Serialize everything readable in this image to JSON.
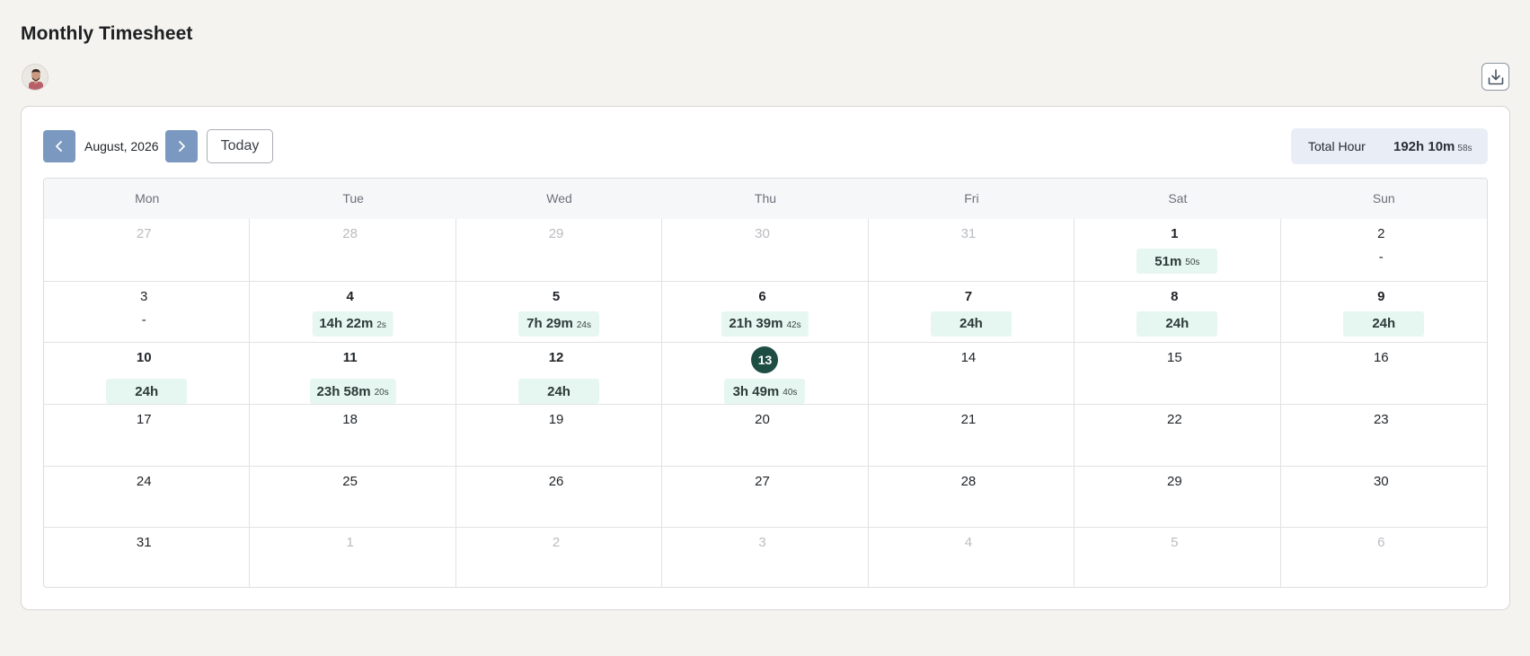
{
  "page": {
    "title": "Monthly Timesheet"
  },
  "toolbar": {
    "month_label": "August, 2026",
    "today_label": "Today",
    "prev_icon": "chevron-left-icon",
    "next_icon": "chevron-right-icon",
    "download_icon": "download-icon"
  },
  "total": {
    "label": "Total Hour",
    "value": "192h 10m",
    "seconds": "58s"
  },
  "calendar": {
    "weekdays": [
      "Mon",
      "Tue",
      "Wed",
      "Thu",
      "Fri",
      "Sat",
      "Sun"
    ],
    "cells": [
      {
        "day": "27",
        "muted": true
      },
      {
        "day": "28",
        "muted": true
      },
      {
        "day": "29",
        "muted": true
      },
      {
        "day": "30",
        "muted": true
      },
      {
        "day": "31",
        "muted": true
      },
      {
        "day": "1",
        "bold": true,
        "time": "51m",
        "sec": "50s"
      },
      {
        "day": "2",
        "dash": "-"
      },
      {
        "day": "3",
        "dash": "-"
      },
      {
        "day": "4",
        "bold": true,
        "time": "14h 22m",
        "sec": "2s"
      },
      {
        "day": "5",
        "bold": true,
        "time": "7h 29m",
        "sec": "24s"
      },
      {
        "day": "6",
        "bold": true,
        "time": "21h 39m",
        "sec": "42s"
      },
      {
        "day": "7",
        "bold": true,
        "time": "24h"
      },
      {
        "day": "8",
        "bold": true,
        "time": "24h"
      },
      {
        "day": "9",
        "bold": true,
        "time": "24h"
      },
      {
        "day": "10",
        "bold": true,
        "time": "24h",
        "lower": true
      },
      {
        "day": "11",
        "bold": true,
        "time": "23h 58m",
        "sec": "20s",
        "lower": true
      },
      {
        "day": "12",
        "bold": true,
        "time": "24h",
        "lower": true
      },
      {
        "day": "13",
        "today": true,
        "time": "3h 49m",
        "sec": "40s",
        "lower": true
      },
      {
        "day": "14"
      },
      {
        "day": "15"
      },
      {
        "day": "16"
      },
      {
        "day": "17"
      },
      {
        "day": "18"
      },
      {
        "day": "19"
      },
      {
        "day": "20"
      },
      {
        "day": "21"
      },
      {
        "day": "22"
      },
      {
        "day": "23"
      },
      {
        "day": "24"
      },
      {
        "day": "25"
      },
      {
        "day": "26"
      },
      {
        "day": "27"
      },
      {
        "day": "28"
      },
      {
        "day": "29"
      },
      {
        "day": "30"
      },
      {
        "day": "31"
      },
      {
        "day": "1",
        "muted": true
      },
      {
        "day": "2",
        "muted": true
      },
      {
        "day": "3",
        "muted": true
      },
      {
        "day": "4",
        "muted": true
      },
      {
        "day": "5",
        "muted": true
      },
      {
        "day": "6",
        "muted": true
      }
    ]
  },
  "colors": {
    "accent": "#7b98c0",
    "today_circle": "#1e4d44",
    "chip_bg": "#e6f7f1",
    "total_bg": "#e9edf6"
  }
}
